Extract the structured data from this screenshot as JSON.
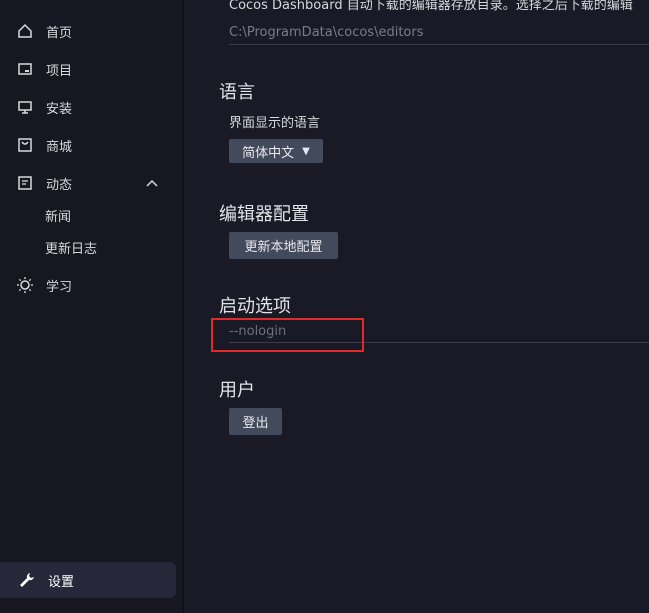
{
  "sidebar": {
    "items": [
      {
        "label": "首页",
        "icon": "home-icon"
      },
      {
        "label": "项目",
        "icon": "folder-icon"
      },
      {
        "label": "安装",
        "icon": "monitor-icon"
      },
      {
        "label": "商城",
        "icon": "store-icon"
      },
      {
        "label": "动态",
        "icon": "news-icon",
        "expanded": true,
        "children": [
          "新闻",
          "更新日志"
        ]
      },
      {
        "label": "学习",
        "icon": "sun-icon"
      }
    ],
    "settings": {
      "label": "设置",
      "icon": "wrench-icon"
    }
  },
  "main": {
    "editor_storage": {
      "description": "Cocos Dashboard 自动下载的编辑器存放目录。选择之后下载的编辑",
      "path_value": "C:\\ProgramData\\cocos\\editors"
    },
    "language": {
      "title": "语言",
      "label": "界面显示的语言",
      "selected": "简体中文"
    },
    "editor_config": {
      "title": "编辑器配置",
      "button": "更新本地配置"
    },
    "startup": {
      "title": "启动选项",
      "placeholder": "--nologin"
    },
    "user": {
      "title": "用户",
      "button": "登出"
    }
  },
  "colors": {
    "highlight": "#e02a2a",
    "button_bg": "#434a5c",
    "sidebar_active": "#27273a"
  }
}
